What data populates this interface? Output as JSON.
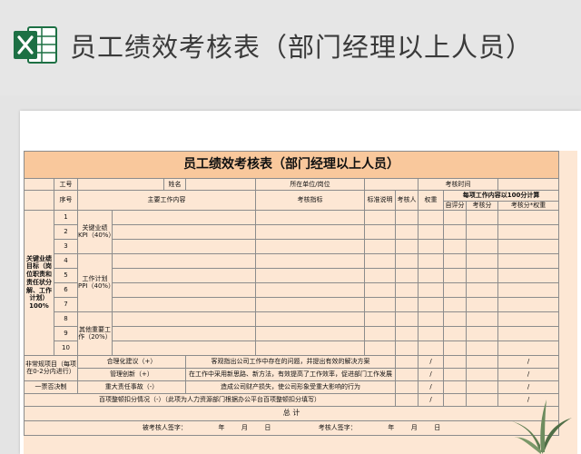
{
  "app": {
    "title": "员工绩效考核表（部门经理以上人员）"
  },
  "sheet": {
    "title": "员工绩效考核表（部门经理以上人员）",
    "info_row": {
      "emp_no_label": "工号",
      "name_label": "姓名",
      "unit_label": "所在单位/岗位",
      "period_label": "考核时间"
    },
    "headers": {
      "seq": "序号",
      "main_work": "主要工作内容",
      "indicator": "考核指标",
      "standard": "标准说明",
      "assessor": "考核人",
      "weight": "权重",
      "score_group": "每项工作内容以100分计算",
      "self_score": "自评分",
      "assess_score": "考核分",
      "weighted_score": "考核分*权重"
    },
    "section_kpi": {
      "label": "关键业绩目标（岗位职责和责任状分解、工作计划）100%",
      "rows": [
        "1",
        "2",
        "3",
        "4",
        "5",
        "6",
        "7",
        "8",
        "9",
        "10"
      ],
      "groups": [
        {
          "label": "关键业绩KPI（40%）"
        },
        {
          "label": "工作计划PPI（40%）"
        },
        {
          "label": "其他重要工作（20%）"
        }
      ]
    },
    "section_other": {
      "label": "非常规项目（每项在0-2分内进行）",
      "items": [
        {
          "item": "合理化建议（+）",
          "desc": "客观指出公司工作中存在的问题，并提出有效的解决方案",
          "slash1": "/",
          "slash2": "/"
        },
        {
          "item": "管理创新（+）",
          "desc": "在工作中采用新思路、新方法，有效提高了工作效率，促进部门工作发展",
          "slash1": "/",
          "slash2": "/"
        }
      ]
    },
    "section_veto": {
      "label": "一票否决制",
      "item": "重大责任事故（-）",
      "desc": "造成公司财产损失，使公司形象受重大影响的行为",
      "slash1": "/",
      "slash2": "/"
    },
    "deduction_row": {
      "label": "百项整顿扣分情况（-）（此项为人力资源部门根据办公平台百项整顿扣分填写）",
      "slash1": "/",
      "slash2": "/"
    },
    "total_label": "总  计",
    "footer": {
      "employee_sign": "被考核人签字：",
      "assessor_sign": "考核人签字：",
      "year": "年",
      "month": "月",
      "day": "日"
    }
  },
  "colors": {
    "title_band": "#f9c89c",
    "table_fill": "#fde7d4",
    "excel_green": "#1d7044"
  }
}
